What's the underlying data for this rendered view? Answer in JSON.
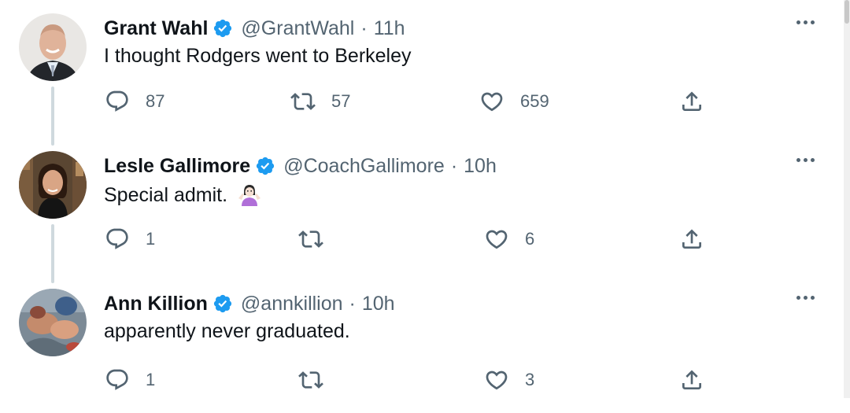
{
  "tweets": [
    {
      "name": "Grant Wahl",
      "handle": "@GrantWahl",
      "separator": "·",
      "time": "11h",
      "text": "I thought Rodgers went to Berkeley",
      "emoji": "",
      "replies": "87",
      "retweets": "57",
      "likes": "659"
    },
    {
      "name": "Lesle Gallimore",
      "handle": "@CoachGallimore",
      "separator": "·",
      "time": "10h",
      "text": "Special admit.",
      "emoji": "🤷🏻‍♀️",
      "replies": "1",
      "retweets": "",
      "likes": "6"
    },
    {
      "name": "Ann Killion",
      "handle": "@annkillion",
      "separator": "·",
      "time": "10h",
      "text": "apparently never graduated.",
      "emoji": "",
      "replies": "1",
      "retweets": "",
      "likes": "3"
    }
  ],
  "colors": {
    "verified": "#1d9bf0",
    "secondary_text": "#536471",
    "primary_text": "#0f1419",
    "thread_line": "#cfd9de"
  },
  "icons": {
    "reply": "reply-icon",
    "retweet": "retweet-icon",
    "like": "heart-icon",
    "share": "share-icon",
    "more": "more-icon",
    "verified": "verified-badge-icon"
  }
}
